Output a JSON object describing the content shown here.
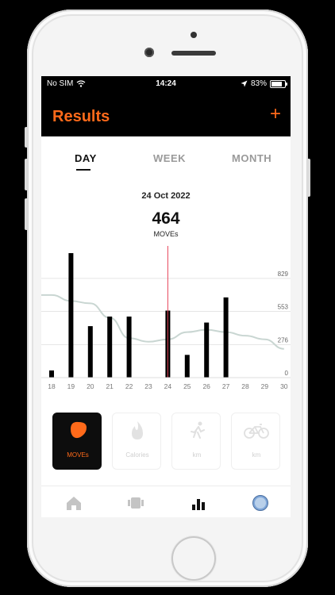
{
  "status_bar": {
    "carrier": "No SIM",
    "time": "14:24",
    "battery_percent": "83%",
    "battery_level": 0.83
  },
  "header": {
    "title": "Results",
    "add_label": "+"
  },
  "tabs": [
    {
      "label": "DAY",
      "active": true
    },
    {
      "label": "WEEK",
      "active": false
    },
    {
      "label": "MONTH",
      "active": false
    }
  ],
  "summary": {
    "date": "24 Oct 2022",
    "value": "464",
    "unit": "MOVEs"
  },
  "chart_data": {
    "type": "bar",
    "categories": [
      "18",
      "19",
      "20",
      "21",
      "22",
      "23",
      "24",
      "25",
      "26",
      "27",
      "28",
      "29",
      "30"
    ],
    "values": [
      60,
      1040,
      430,
      510,
      510,
      0,
      560,
      190,
      460,
      670,
      0,
      0,
      0
    ],
    "y_ticks": [
      "0",
      "276",
      "553",
      "829"
    ],
    "y_tick_values": [
      0,
      276,
      553,
      829
    ],
    "ylim": [
      0,
      1100
    ],
    "selected_category": "24",
    "trend": {
      "x": [
        "17",
        "18",
        "19",
        "20",
        "21",
        "22",
        "23",
        "24",
        "25",
        "26",
        "27",
        "28",
        "29",
        "30"
      ],
      "y": [
        690,
        690,
        640,
        620,
        500,
        330,
        300,
        320,
        380,
        400,
        380,
        350,
        320,
        240
      ]
    },
    "colors": {
      "bar": "#000000",
      "trend": "#c9d6d2",
      "selection": "#e8445a",
      "grid": "#e5e5e5"
    }
  },
  "cards": [
    {
      "label": "MOVEs",
      "icon": "moves-blob-icon",
      "active": true
    },
    {
      "label": "Calories",
      "icon": "flame-icon",
      "active": false
    },
    {
      "label": "km",
      "icon": "running-icon",
      "active": false
    },
    {
      "label": "km",
      "icon": "bicycle-icon",
      "active": false
    }
  ],
  "bottom_nav": [
    {
      "icon": "home-icon",
      "active": false
    },
    {
      "icon": "watch-icon",
      "active": false
    },
    {
      "icon": "bar-chart-icon",
      "active": true
    },
    {
      "icon": "profile-icon",
      "active": false
    }
  ],
  "colors": {
    "accent": "#ff6a1a",
    "header_bg": "#000000"
  }
}
